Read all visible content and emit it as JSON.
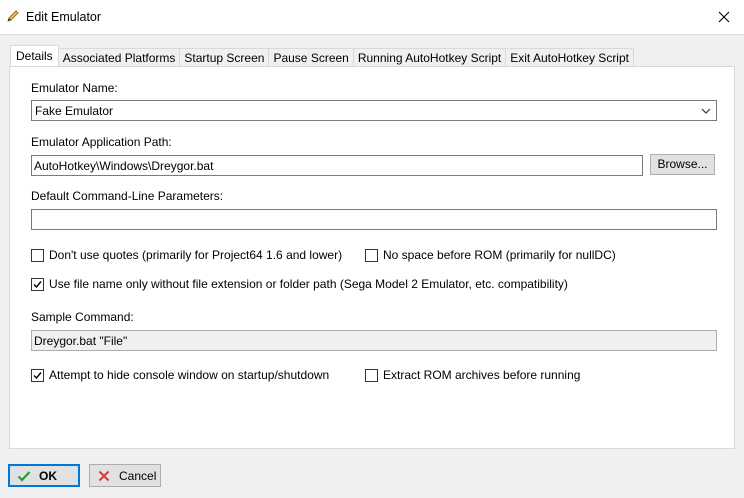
{
  "window": {
    "title": "Edit Emulator",
    "title_icon": "pencil-icon",
    "close_icon": "close-icon"
  },
  "tabs": [
    {
      "label": "Details",
      "active": true
    },
    {
      "label": "Associated Platforms",
      "active": false
    },
    {
      "label": "Startup Screen",
      "active": false
    },
    {
      "label": "Pause Screen",
      "active": false
    },
    {
      "label": "Running AutoHotkey Script",
      "active": false
    },
    {
      "label": "Exit AutoHotkey Script",
      "active": false
    }
  ],
  "details": {
    "emulator_name_label": "Emulator Name:",
    "emulator_name_value": "Fake Emulator",
    "app_path_label": "Emulator Application Path:",
    "app_path_value": "AutoHotkey\\Windows\\Dreygor.bat",
    "browse_label": "Browse...",
    "params_label": "Default Command-Line Parameters:",
    "params_value": "",
    "opt_no_quotes": {
      "label": "Don't use quotes (primarily for Project64 1.6 and lower)",
      "checked": false
    },
    "opt_no_space": {
      "label": "No space before ROM (primarily for nullDC)",
      "checked": false
    },
    "opt_file_name_only": {
      "label": "Use file name only without file extension or folder path (Sega Model 2 Emulator, etc. compatibility)",
      "checked": true
    },
    "sample_label": "Sample Command:",
    "sample_value": "Dreygor.bat \"File\"",
    "opt_hide_console": {
      "label": "Attempt to hide console window on startup/shutdown",
      "checked": true
    },
    "opt_extract_rom": {
      "label": "Extract ROM archives before running",
      "checked": false
    }
  },
  "footer": {
    "ok_label": "OK",
    "cancel_label": "Cancel"
  },
  "colors": {
    "ok_check": "#2e9e2e",
    "cancel_x": "#d33a3a",
    "default_border": "#0078d7"
  }
}
